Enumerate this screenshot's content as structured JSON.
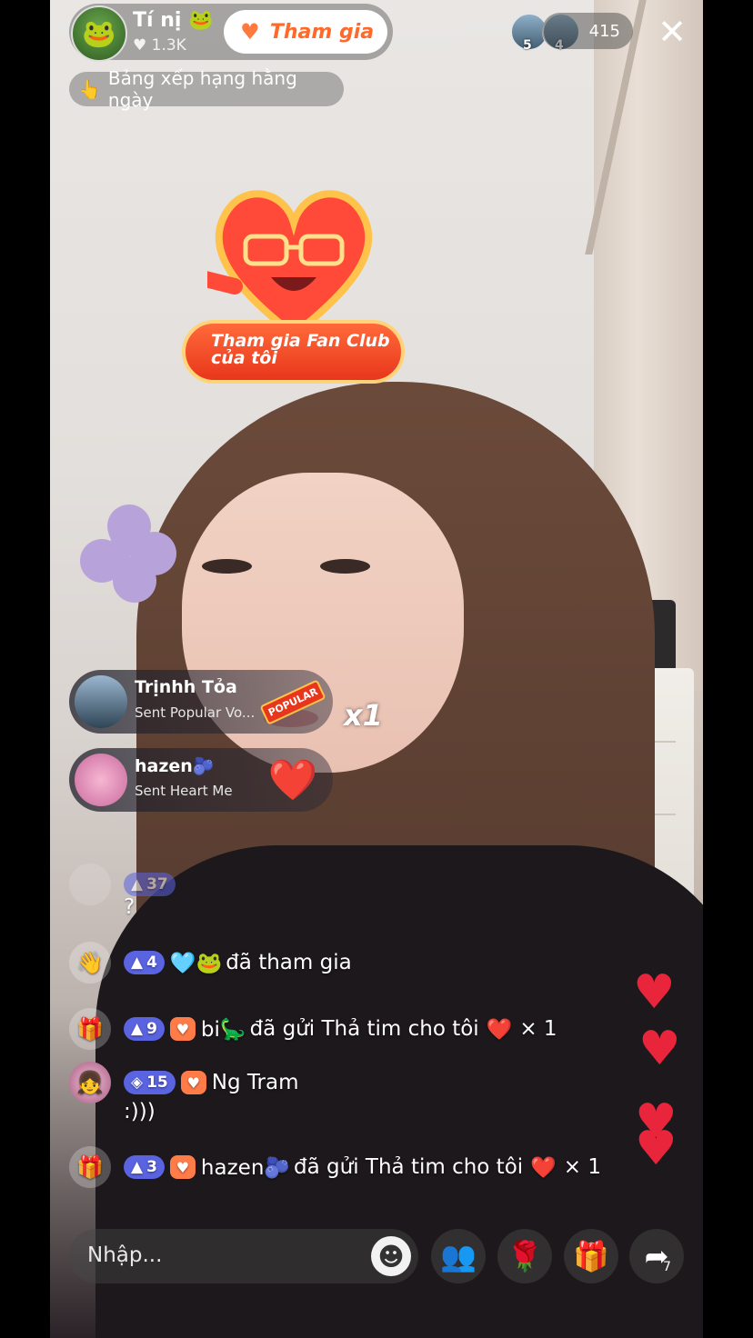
{
  "host": {
    "name": "Tí nị 🐸",
    "likes": "♥ 1.3K",
    "avatar_emoji": "🐸",
    "join_label": "Tham gia"
  },
  "viewers": {
    "avatars": [
      {
        "badge": "5"
      },
      {
        "badge": "4"
      }
    ],
    "count": "415"
  },
  "close_icon": "✕",
  "ranking": {
    "icon": "👆",
    "label": "Bảng xếp hạng hằng ngày"
  },
  "fan_club": {
    "line1": "Tham gia Fan Club",
    "line2": "của tôi"
  },
  "gift_banners": [
    {
      "name": "Trịnhh Tỏa",
      "subtitle": "Sent Popular Vo...",
      "gift_icon": "POPULAR",
      "multiplier": "x1"
    },
    {
      "name": "hazen🫐",
      "subtitle": "Sent Heart Me",
      "gift_icon": "❤️"
    }
  ],
  "chat": [
    {
      "type": "comment",
      "avatar": "",
      "level": "37",
      "name": "",
      "text": "?"
    },
    {
      "type": "join",
      "avatar": "👋",
      "level": "4",
      "name": "🩵🐸",
      "text": "đã tham gia"
    },
    {
      "type": "gift",
      "avatar": "🎁",
      "level": "9",
      "name": "bi🦕",
      "text": "đã gửi Thả tim cho tôi",
      "gift": "❤️",
      "count": "× 1"
    },
    {
      "type": "comment",
      "avatar": "👧",
      "level": "15",
      "name": "Ng Tram",
      "text": ":)))"
    },
    {
      "type": "gift",
      "avatar": "🎁",
      "level": "3",
      "name": "hazen🫐",
      "text": "đã gửi Thả tim cho tôi",
      "gift": "❤️",
      "count": "× 1"
    }
  ],
  "bottom": {
    "input_placeholder": "Nhập...",
    "emoji_icon": "☻",
    "buttons": [
      "👥",
      "🌹",
      "🎁",
      "➦"
    ],
    "share_count": "7"
  },
  "colors": {
    "accent": "#ff6a2b",
    "level_badge": "#5a63e0",
    "heart": "#e8253a"
  }
}
